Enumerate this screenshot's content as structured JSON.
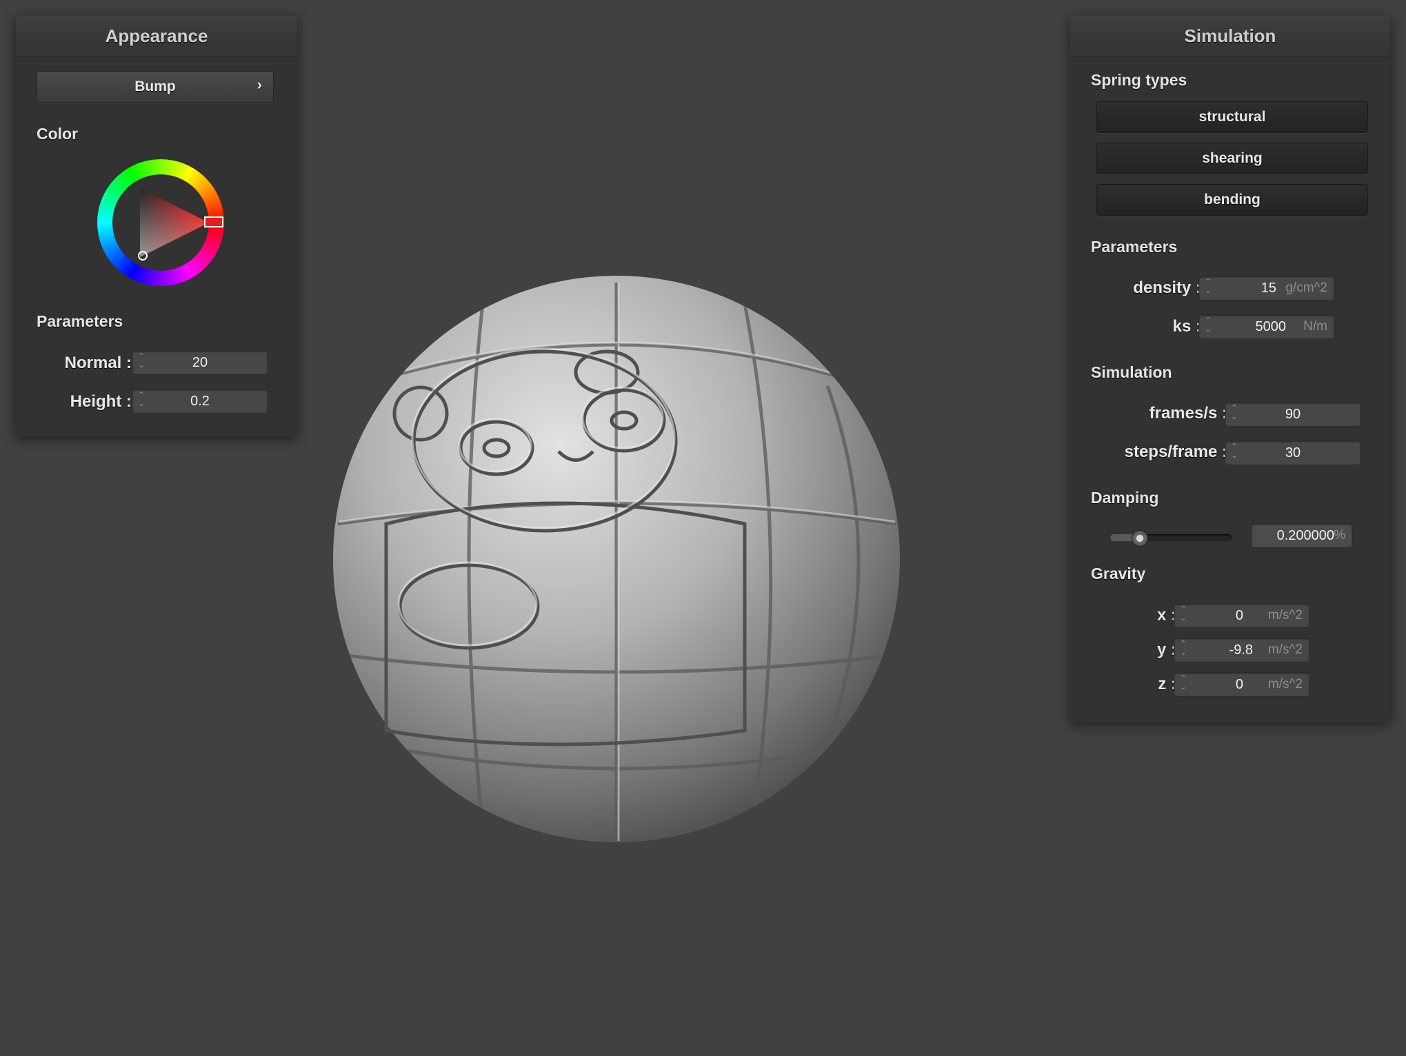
{
  "appearance": {
    "title": "Appearance",
    "shader_button": "Bump",
    "shader_chevron": "›",
    "color_label": "Color",
    "params_label": "Parameters",
    "normal_label": "Normal :",
    "normal_value": "20",
    "height_label": "Height :",
    "height_value": "0.2",
    "color_wheel": {
      "selected_hex": "#e02020"
    }
  },
  "simulation": {
    "title": "Simulation",
    "spring_types_label": "Spring types",
    "spring_buttons": [
      "structural",
      "shearing",
      "bending"
    ],
    "parameters_label": "Parameters",
    "density_label": "density :",
    "density_value": "15",
    "density_unit": "g/cm^2",
    "ks_label": "ks :",
    "ks_value": "5000",
    "ks_unit": "N/m",
    "sim_label": "Simulation",
    "fps_label": "frames/s :",
    "fps_value": "90",
    "steps_label": "steps/frame :",
    "steps_value": "30",
    "damping_label": "Damping",
    "damping_value": "0.200000",
    "damping_unit": "%",
    "damping_slider_fraction": 0.2,
    "gravity_label": "Gravity",
    "gx_label": "x :",
    "gx_value": "0",
    "gy_label": "y :",
    "gy_value": "-9.8",
    "gz_label": "z :",
    "gz_value": "0",
    "gravity_unit": "m/s^2"
  },
  "icons": {
    "spinner": "spinner-arrows-icon"
  },
  "colors": {
    "background": "#414141",
    "panel": "#323232",
    "field": "#474747"
  }
}
